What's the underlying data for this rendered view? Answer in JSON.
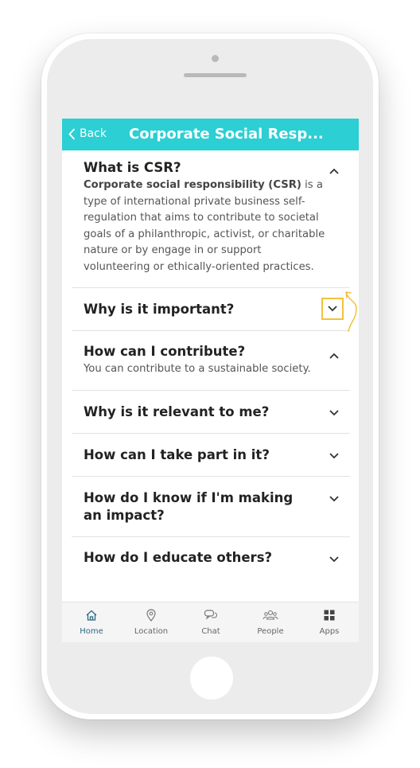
{
  "header": {
    "back_label": "Back",
    "title": "Corporate Social Resp..."
  },
  "faq": [
    {
      "question": "What is CSR?",
      "expanded": true,
      "answer_bold": "Corporate social responsibility (CSR)",
      "answer_rest": " is a type of international private business self-regulation that aims to contribute to societal goals of a philanthropic, activist, or charitable nature or by engage in or support volunteering or ethically-oriented practices."
    },
    {
      "question": "Why is it important?",
      "expanded": false,
      "highlighted": true
    },
    {
      "question": "How can I contribute?",
      "expanded": true,
      "answer": "You can contribute to a sustainable society."
    },
    {
      "question": "Why is it relevant to me?",
      "expanded": false
    },
    {
      "question": "How can I take part in it?",
      "expanded": false
    },
    {
      "question": "How do I know if I'm making an impact?",
      "expanded": false
    },
    {
      "question": "How do I educate others?",
      "expanded": false
    }
  ],
  "tabs": [
    {
      "label": "Home",
      "icon": "home-icon",
      "active": true
    },
    {
      "label": "Location",
      "icon": "location-pin-icon"
    },
    {
      "label": "Chat",
      "icon": "chat-icon"
    },
    {
      "label": "People",
      "icon": "people-icon"
    },
    {
      "label": "Apps",
      "icon": "apps-grid-icon"
    }
  ],
  "colors": {
    "accent": "#2ccfd3",
    "highlight": "#f3c13a",
    "active_tab": "#2a6b82"
  }
}
